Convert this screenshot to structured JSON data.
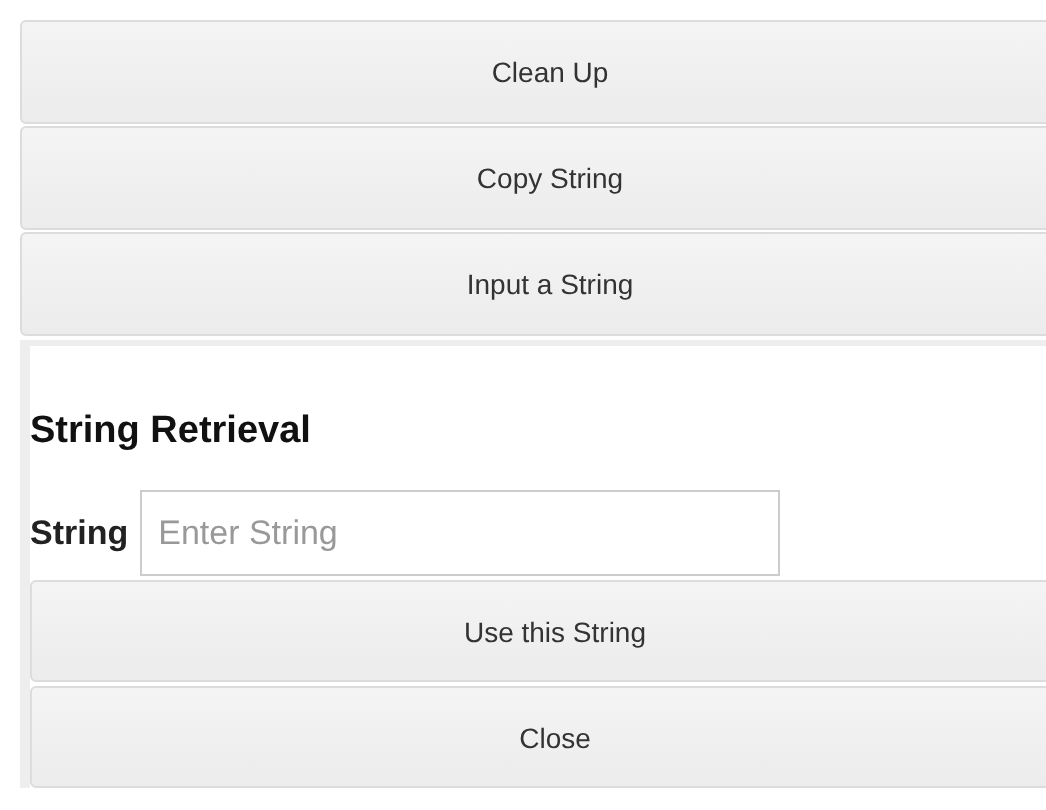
{
  "menu_buttons": [
    "Clean Up",
    "Copy String",
    "Input a String"
  ],
  "panel": {
    "title": "String Retrieval",
    "field": {
      "label": "String",
      "placeholder": "Enter String"
    },
    "buttons": [
      "Use this String",
      "Close"
    ]
  }
}
